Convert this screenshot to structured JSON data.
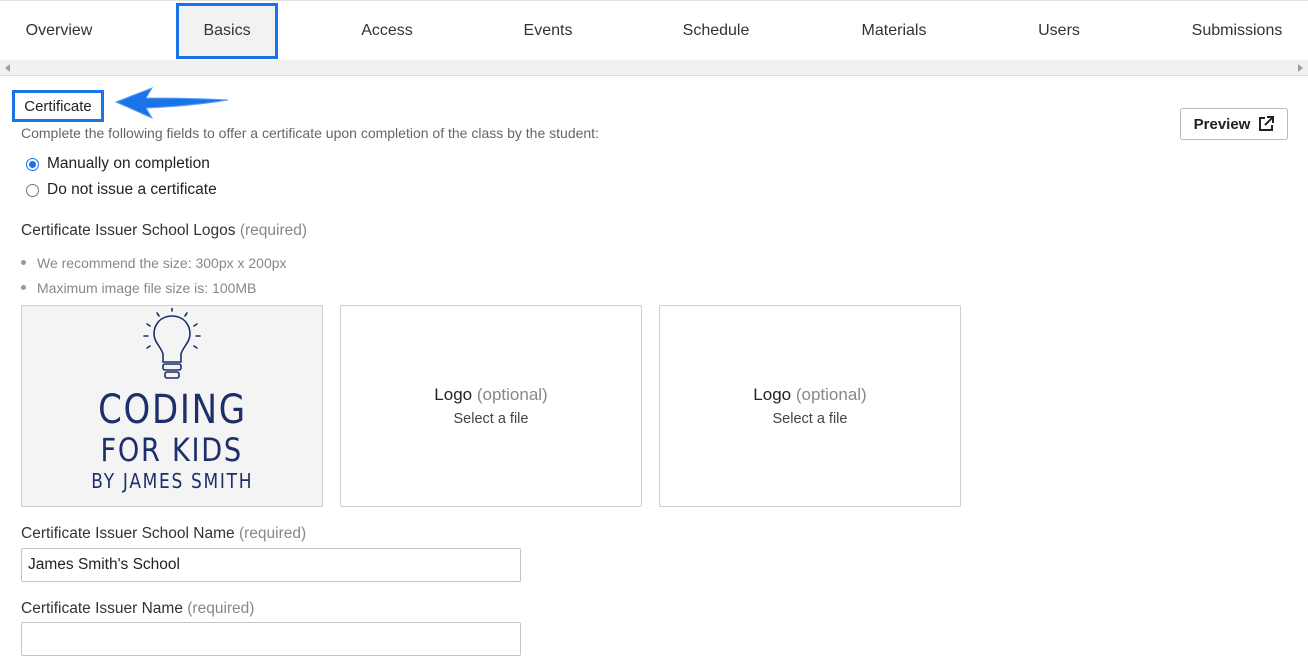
{
  "tabs": [
    {
      "label": "Overview"
    },
    {
      "label": "Basics"
    },
    {
      "label": "Access"
    },
    {
      "label": "Events"
    },
    {
      "label": "Schedule"
    },
    {
      "label": "Materials"
    },
    {
      "label": "Users"
    },
    {
      "label": "Submissions"
    }
  ],
  "active_tab": "Basics",
  "certificate": {
    "title": "Certificate",
    "description": "Complete the following fields to offer a certificate upon completion of the class by the student:",
    "preview_label": "Preview",
    "options": [
      {
        "label": "Manually on completion",
        "checked": true
      },
      {
        "label": "Do not issue a certificate",
        "checked": false
      }
    ],
    "logos_label": "Certificate Issuer School Logos",
    "required_text": "(required)",
    "hints": [
      "We recommend the size: 300px x 200px",
      "Maximum image file size is: 100MB"
    ],
    "uploaded_logo": {
      "line1": "CODING",
      "line2": "FOR KIDS",
      "line3": "BY JAMES SMITH"
    },
    "logo_slots": [
      {
        "title": "Logo",
        "optional": "(optional)",
        "action": "Select a file"
      },
      {
        "title": "Logo",
        "optional": "(optional)",
        "action": "Select a file"
      }
    ],
    "school_name_label": "Certificate Issuer School Name",
    "school_name_value": "James Smith's School",
    "issuer_name_label": "Certificate Issuer Name"
  },
  "colors": {
    "accent": "#1a73e8",
    "logo_navy": "#1d2f6b"
  }
}
